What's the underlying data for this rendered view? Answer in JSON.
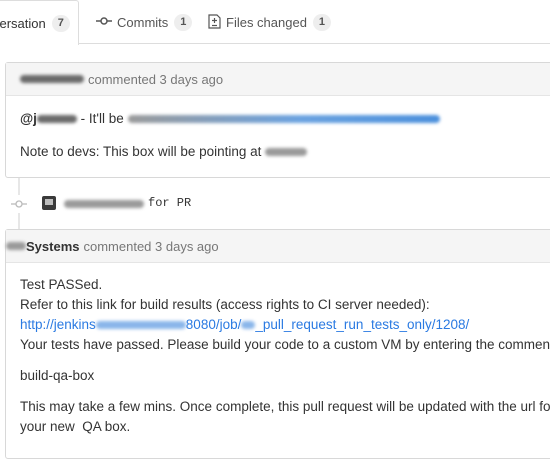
{
  "tabs": [
    {
      "label": "versation",
      "count": "7",
      "icon": ""
    },
    {
      "label": "Commits",
      "count": "1",
      "icon": "commit-icon"
    },
    {
      "label": "Files changed",
      "count": "1",
      "icon": "file-diff-icon"
    }
  ],
  "comment1": {
    "header_suffix": "commented 3 days ago",
    "mention_prefix": "@j",
    "line1_text": " - It'll be ",
    "line2_text": "Note to devs: This box will be pointing at "
  },
  "commit": {
    "text": "for PR"
  },
  "comment2": {
    "author": "Systems",
    "header_suffix": "commented 3 days ago",
    "line1": "Test PASSed.",
    "line2": "Refer to this link for build results (access rights to CI server needed):",
    "link_prefix": "http://jenkins",
    "link_mid": "8080/job/",
    "link_suffix": "_pull_request_run_tests_only/1208/",
    "line4": "Your tests have passed. Please build your code to a custom VM by entering the comment:",
    "command": "build-qa-box",
    "line6": "This may take a few mins. Once complete, this pull request will be updated with the url for",
    "line7": "your new  QA box."
  },
  "colors": {
    "link": "#2a7ae2",
    "border": "#d8d8d8",
    "header_bg": "#f5f5f5"
  }
}
